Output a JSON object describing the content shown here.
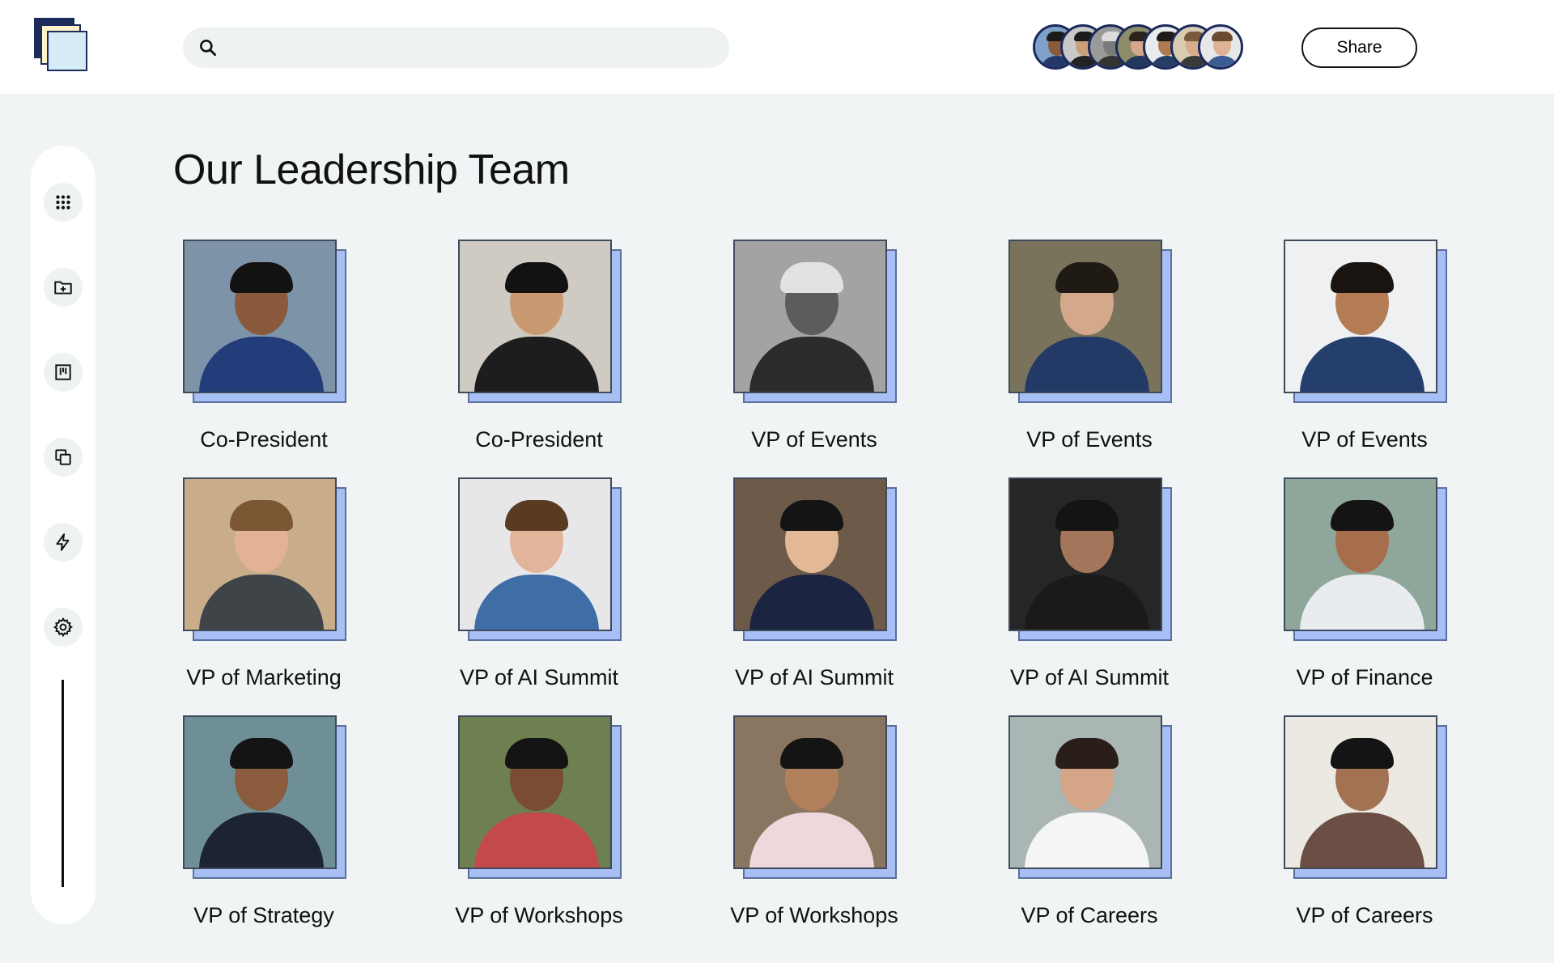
{
  "header": {
    "search": {
      "placeholder": "",
      "value": ""
    },
    "share_label": "Share",
    "avatars": [
      {
        "bg": "#7fa0c8",
        "skin": "#8a5a3c",
        "hair": "#1b1b1b",
        "shirt": "#24386a"
      },
      {
        "bg": "#c9c9c9",
        "skin": "#caa07a",
        "hair": "#1b1b1b",
        "shirt": "#222222"
      },
      {
        "bg": "#9a9a9a",
        "skin": "#7a7a7a",
        "hair": "#dcdcdc",
        "shirt": "#333333"
      },
      {
        "bg": "#8c8c6a",
        "skin": "#d4a88a",
        "hair": "#2a221c",
        "shirt": "#23375f"
      },
      {
        "bg": "#e8ecef",
        "skin": "#b07a55",
        "hair": "#1f1a16",
        "shirt": "#263e66"
      },
      {
        "bg": "#d9cbb2",
        "skin": "#d7ab8c",
        "hair": "#7a5a3a",
        "shirt": "#3a3a3a"
      },
      {
        "bg": "#e8e8e8",
        "skin": "#e0b294",
        "hair": "#6a4a30",
        "shirt": "#3b5d94"
      }
    ]
  },
  "page": {
    "title": "Our Leadership Team"
  },
  "team": [
    {
      "role": "Co-President",
      "bg": "#7c93a8",
      "skin": "#8a5a3c",
      "hair": "#121212",
      "shirt": "#233c7a"
    },
    {
      "role": "Co-President",
      "bg": "#cfcac2",
      "skin": "#c99a72",
      "hair": "#121212",
      "shirt": "#1d1d1d"
    },
    {
      "role": "VP of Events",
      "bg": "#a3a3a3",
      "skin": "#5c5c5c",
      "hair": "#e2e2e2",
      "shirt": "#2b2b2b"
    },
    {
      "role": "VP of Events",
      "bg": "#7a735c",
      "skin": "#d4a88a",
      "hair": "#1f1a14",
      "shirt": "#243a66"
    },
    {
      "role": "VP of Events",
      "bg": "#eef0f2",
      "skin": "#b47c55",
      "hair": "#1a1410",
      "shirt": "#243f6b"
    },
    {
      "role": "VP of Marketing",
      "bg": "#c9ad8a",
      "skin": "#e1b294",
      "hair": "#7a5633",
      "shirt": "#3e4448"
    },
    {
      "role": "VP of AI Summit",
      "bg": "#e7e7ea",
      "skin": "#e2b59a",
      "hair": "#5a3b22",
      "shirt": "#3f6ea6"
    },
    {
      "role": "VP of AI Summit",
      "bg": "#6e5a48",
      "skin": "#e2b896",
      "hair": "#141414",
      "shirt": "#1b2440"
    },
    {
      "role": "VP of AI Summit",
      "bg": "#262626",
      "skin": "#a3755a",
      "hair": "#141414",
      "shirt": "#1a1a1a"
    },
    {
      "role": "VP of Finance",
      "bg": "#8ea79a",
      "skin": "#a66e4c",
      "hair": "#141414",
      "shirt": "#e9ecef"
    },
    {
      "role": "VP of Strategy",
      "bg": "#6f8f96",
      "skin": "#8a5b3d",
      "hair": "#141414",
      "shirt": "#1c2433"
    },
    {
      "role": "VP of Workshops",
      "bg": "#6f8050",
      "skin": "#7a4d33",
      "hair": "#141414",
      "shirt": "#c24a4a"
    },
    {
      "role": "VP of Workshops",
      "bg": "#8a7560",
      "skin": "#b07f5c",
      "hair": "#141414",
      "shirt": "#f0d7dc"
    },
    {
      "role": "VP of Careers",
      "bg": "#a9b6b3",
      "skin": "#d4a587",
      "hair": "#2a1f18",
      "shirt": "#f5f5f5"
    },
    {
      "role": "VP of Careers",
      "bg": "#ece9e3",
      "skin": "#a37252",
      "hair": "#141414",
      "shirt": "#6b4f44"
    }
  ],
  "sidebar": {
    "items": [
      {
        "icon": "apps-grid-icon"
      },
      {
        "icon": "folder-add-icon"
      },
      {
        "icon": "board-icon"
      },
      {
        "icon": "copy-icon"
      },
      {
        "icon": "lightning-icon"
      },
      {
        "icon": "settings-gear-icon"
      }
    ]
  }
}
